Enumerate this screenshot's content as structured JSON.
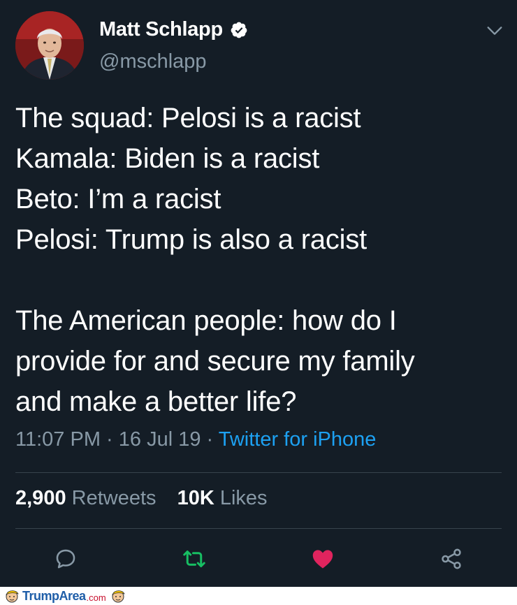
{
  "author": {
    "display_name": "Matt Schlapp",
    "handle": "@mschlapp",
    "verified": true,
    "avatar": "profile-photo"
  },
  "tweet": {
    "lines": [
      "The squad: Pelosi is a racist",
      "Kamala: Biden is a racist",
      "Beto: I’m a racist",
      "Pelosi: Trump is also a racist",
      "",
      "The American people: how do I",
      "provide for and secure my family",
      "and make a better life?"
    ]
  },
  "meta": {
    "time": "11:07 PM",
    "sep1": " · ",
    "date": "16 Jul 19",
    "sep2": " · ",
    "source": "Twitter for iPhone"
  },
  "stats": {
    "retweets_count": "2,900",
    "retweets_label": "Retweets",
    "likes_count": "10K",
    "likes_label": "Likes"
  },
  "actions": {
    "reply_icon": "reply-icon",
    "retweet_icon": "retweet-icon",
    "like_icon": "heart-icon",
    "share_icon": "share-icon"
  },
  "colors": {
    "background": "#141d26",
    "secondary_text": "#8899a6",
    "link": "#1da1f2",
    "retweet": "#17bf63",
    "like": "#e0245e",
    "divider": "#38444d"
  },
  "footer": {
    "brand": "TrumpArea",
    "domain": ".com"
  }
}
